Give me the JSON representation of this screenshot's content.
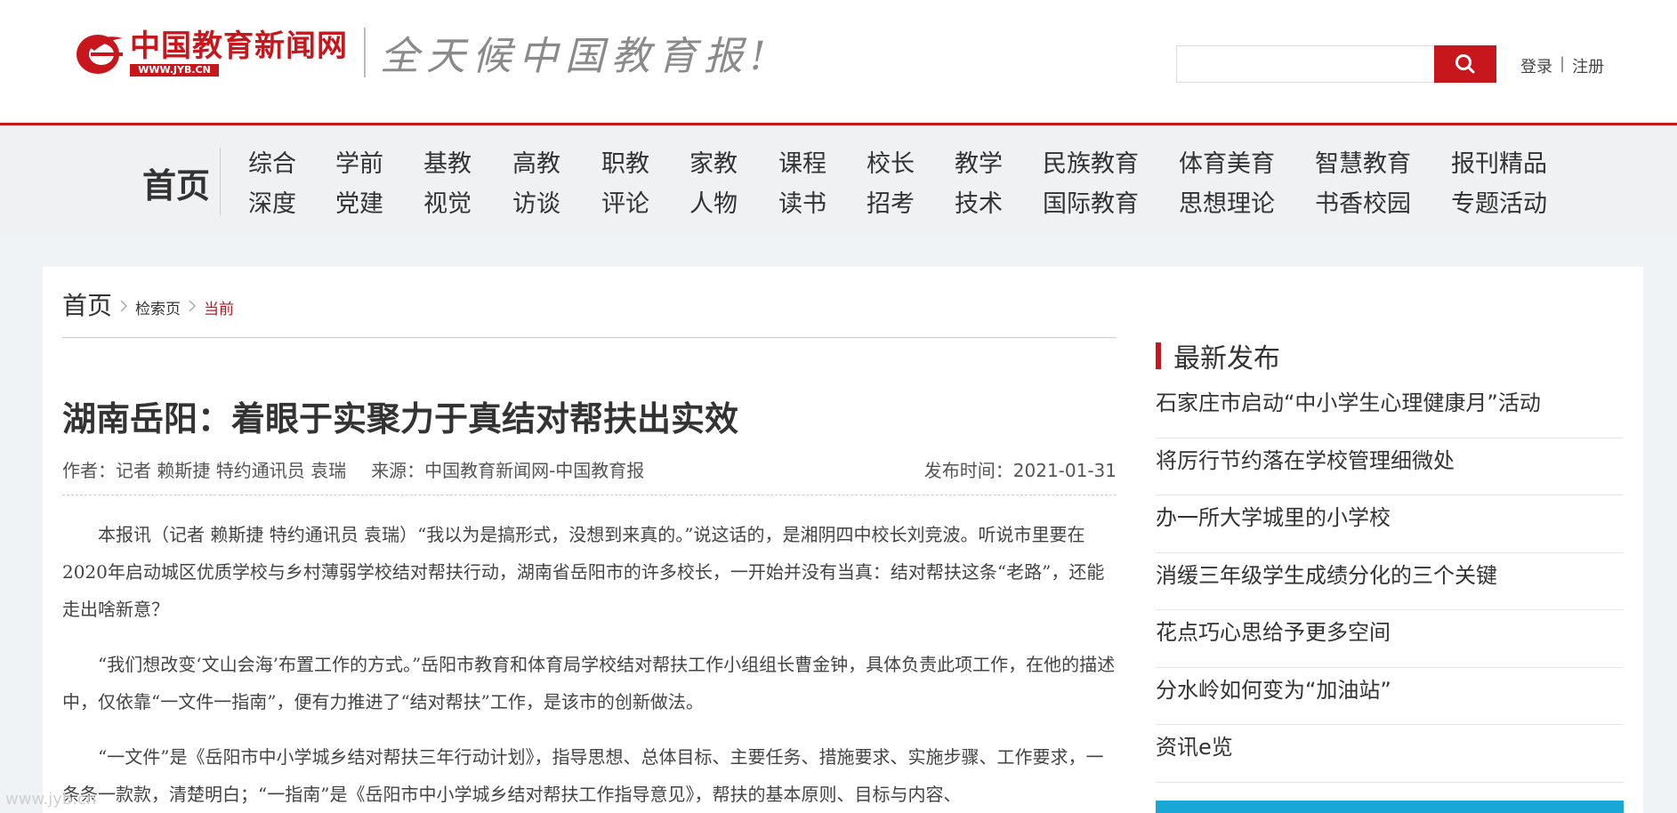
{
  "header": {
    "logo_name": "中国教育新闻网",
    "logo_url": "WWW.JYB.CN",
    "slogan": "全天候中国教育报!",
    "search_placeholder": "",
    "login": "登录",
    "separator": "|",
    "register": "注册"
  },
  "nav": {
    "home": "首页",
    "row1": [
      "综合",
      "学前",
      "基教",
      "高教",
      "职教",
      "家教",
      "课程",
      "校长",
      "教学",
      "民族教育",
      "体育美育",
      "智慧教育",
      "报刊精品"
    ],
    "row2": [
      "深度",
      "党建",
      "视觉",
      "访谈",
      "评论",
      "人物",
      "读书",
      "招考",
      "技术",
      "国际教育",
      "思想理论",
      "书香校园",
      "专题活动"
    ]
  },
  "breadcrumb": {
    "home": "首页",
    "search": "检索页",
    "current": "当前"
  },
  "article": {
    "title": "湖南岳阳：着眼于实聚力于真结对帮扶出实效",
    "author": "作者：记者 赖斯捷 特约通讯员 袁瑞",
    "source": "来源：中国教育新闻网-中国教育报",
    "pubtime": "发布时间：2021-01-31",
    "paragraphs": [
      "本报讯（记者 赖斯捷 特约通讯员 袁瑞）“我以为是搞形式，没想到来真的。”说这话的，是湘阴四中校长刘竞波。听说市里要在2020年启动城区优质学校与乡村薄弱学校结对帮扶行动，湖南省岳阳市的许多校长，一开始并没有当真：结对帮扶这条“老路”，还能走出啥新意？",
      "“我们想改变‘文山会海’布置工作的方式。”岳阳市教育和体育局学校结对帮扶工作小组组长曹金钟，具体负责此项工作，在他的描述中，仅依靠“一文件一指南”，便有力推进了“结对帮扶”工作，是该市的创新做法。",
      "“一文件”是《岳阳市中小学城乡结对帮扶三年行动计划》，指导思想、总体目标、主要任务、措施要求、实施步骤、工作要求，一条条一款款，清楚明白；“一指南”是《岳阳市中小学城乡结对帮扶工作指导意见》，帮扶的基本原则、目标与内容、"
    ]
  },
  "sidebar": {
    "title": "最新发布",
    "items": [
      "石家庄市启动“中小学生心理健康月”活动",
      "将厉行节约落在学校管理细微处",
      "办一所大学城里的小学校",
      "消缓三年级学生成绩分化的三个关键",
      "花点巧心思给予更多空间",
      "分水岭如何变为“加油站”",
      "资讯e览"
    ]
  },
  "watermark": "www.jyb.cn",
  "colors": {
    "brand_red": "#c8161d",
    "nav_bg": "#f0f1f2",
    "page_bg": "#f0f3f6",
    "banner_blue": "#18a7d6"
  }
}
